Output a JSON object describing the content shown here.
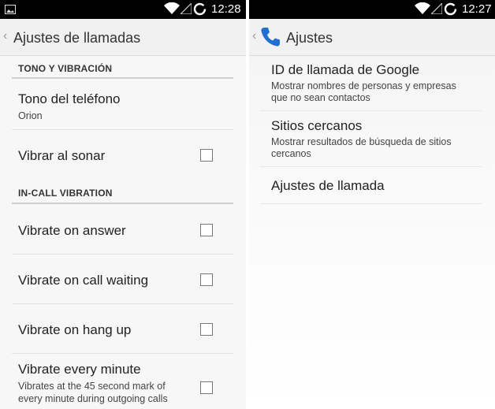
{
  "left": {
    "status": {
      "time": "12:28"
    },
    "action_bar": {
      "title": "Ajustes de llamadas"
    },
    "categories": [
      {
        "label": "TONO Y VIBRACIÓN"
      },
      {
        "label": "IN-CALL VIBRATION"
      }
    ],
    "items": [
      {
        "title": "Tono del teléfono",
        "summary": "Orion"
      },
      {
        "title": "Vibrar al sonar",
        "checked": false
      },
      {
        "title": "Vibrate on answer",
        "checked": false
      },
      {
        "title": "Vibrate on call waiting",
        "checked": false
      },
      {
        "title": "Vibrate on hang up",
        "checked": false
      },
      {
        "title": "Vibrate every minute",
        "summary": "Vibrates at the 45 second mark of every minute during outgoing calls",
        "checked": false
      }
    ]
  },
  "right": {
    "status": {
      "time": "12:27"
    },
    "action_bar": {
      "title": "Ajustes",
      "app_icon": "phone-icon"
    },
    "items": [
      {
        "title": "ID de llamada de Google",
        "summary": "Mostrar nombres de personas y empresas que no sean contactos"
      },
      {
        "title": "Sitios cercanos",
        "summary": "Mostrar resultados de búsqueda de sitios cercanos"
      },
      {
        "title": "Ajustes de llamada"
      }
    ]
  },
  "colors": {
    "status_bar": "#000000",
    "action_bar": "#f1f1f1",
    "phone_icon": "#1f6fd6"
  }
}
